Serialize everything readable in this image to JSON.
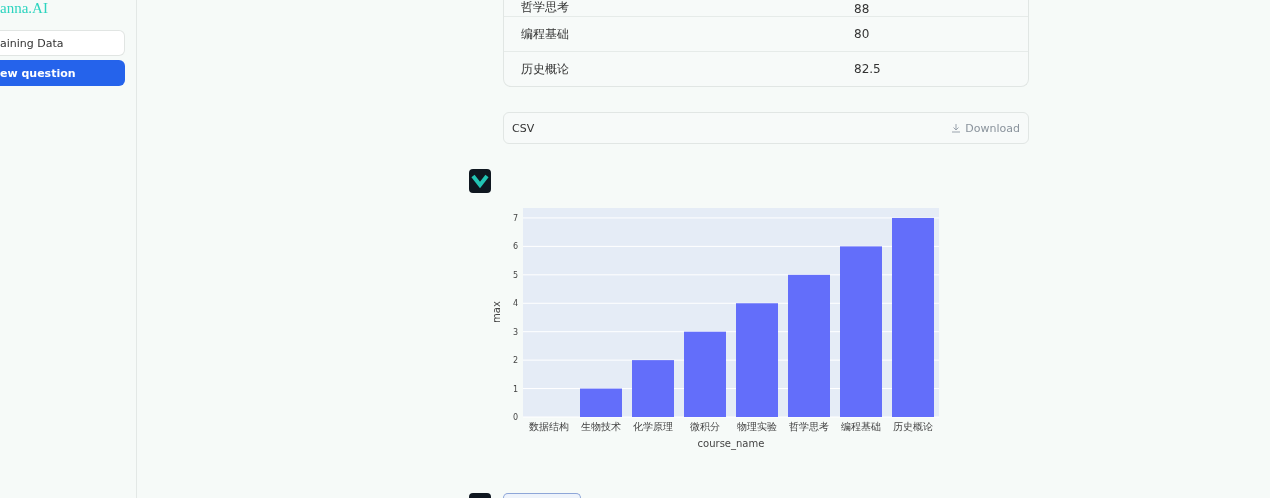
{
  "sidebar": {
    "logo": "anna.AI",
    "items": [
      {
        "label": "aining Data",
        "kind": "outline"
      },
      {
        "label": "ew question",
        "kind": "primary"
      }
    ]
  },
  "table": {
    "rows": [
      [
        "哲学思考",
        "88"
      ],
      [
        "编程基础",
        "80"
      ],
      [
        "历史概论",
        "82.5"
      ]
    ]
  },
  "download_bar": {
    "format": "CSV",
    "action": "Download"
  },
  "chart": {
    "chart_data": {
      "type": "bar",
      "xlabel": "course_name",
      "ylabel": "max",
      "categories": [
        "数据结构",
        "生物技术",
        "化学原理",
        "微积分",
        "物理实验",
        "哲学思考",
        "编程基础",
        "历史概论"
      ],
      "values": [
        0,
        1,
        2,
        3,
        4,
        5,
        6,
        7
      ],
      "yticks": [
        0,
        1,
        2,
        3,
        4,
        5,
        6,
        7
      ],
      "ylim": [
        0,
        7.35
      ],
      "grid": true
    }
  }
}
